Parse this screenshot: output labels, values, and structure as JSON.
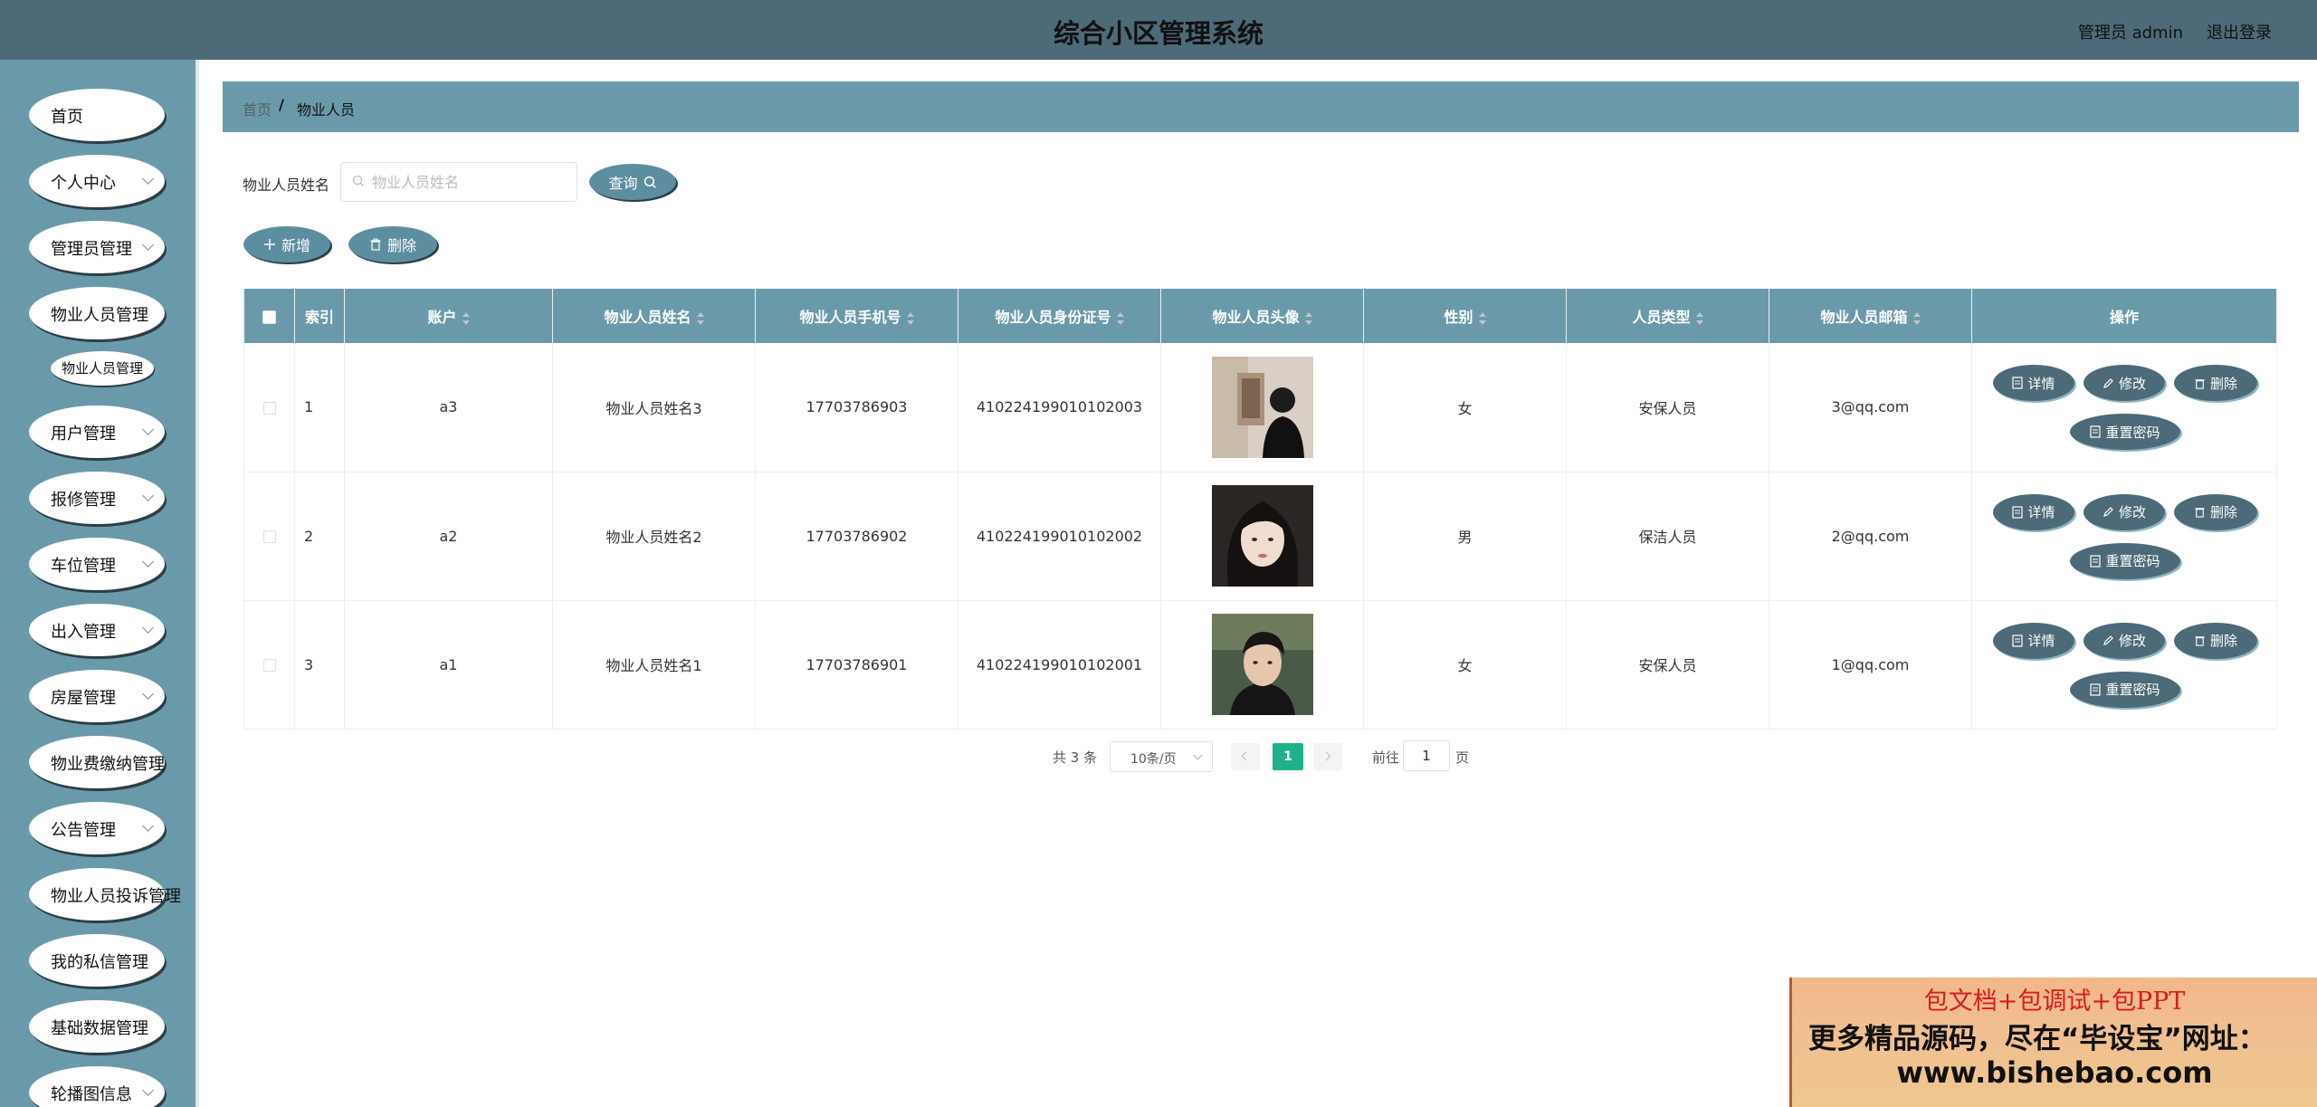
{
  "header": {
    "title": "综合小区管理系统",
    "user": "管理员 admin",
    "logout": "退出登录"
  },
  "sidebar": {
    "items": [
      {
        "label": "首页",
        "has_sub": false
      },
      {
        "label": "个人中心",
        "has_sub": true
      },
      {
        "label": "管理员管理",
        "has_sub": true
      },
      {
        "label": "物业人员管理",
        "has_sub": false
      },
      {
        "label": "用户管理",
        "has_sub": true
      },
      {
        "label": "报修管理",
        "has_sub": true
      },
      {
        "label": "车位管理",
        "has_sub": true
      },
      {
        "label": "出入管理",
        "has_sub": true
      },
      {
        "label": "房屋管理",
        "has_sub": true
      },
      {
        "label": "物业费缴纳管理",
        "has_sub": false
      },
      {
        "label": "公告管理",
        "has_sub": true
      },
      {
        "label": "物业人员投诉管理",
        "has_sub": false
      },
      {
        "label": "我的私信管理",
        "has_sub": false
      },
      {
        "label": "基础数据管理",
        "has_sub": false
      },
      {
        "label": "轮播图信息",
        "has_sub": true
      }
    ],
    "sub_item": "物业人员管理"
  },
  "breadcrumb": {
    "home": "首页",
    "separator": "/",
    "current": "物业人员"
  },
  "search": {
    "label": "物业人员姓名",
    "placeholder": "物业人员姓名",
    "value": "",
    "query_button": "查询"
  },
  "toolbar": {
    "add_button": "新增",
    "delete_button": "删除"
  },
  "table": {
    "columns": [
      "索引",
      "账户",
      "物业人员姓名",
      "物业人员手机号",
      "物业人员身份证号",
      "物业人员头像",
      "性别",
      "人员类型",
      "物业人员邮箱",
      "操作"
    ],
    "rows": [
      {
        "index": "1",
        "account": "a3",
        "name": "物业人员姓名3",
        "phone": "17703786903",
        "id_card": "410224199010102003",
        "avatar": "photo-back-view",
        "gender": "女",
        "type": "安保人员",
        "email": "3@qq.com"
      },
      {
        "index": "2",
        "account": "a2",
        "name": "物业人员姓名2",
        "phone": "17703786902",
        "id_card": "410224199010102002",
        "avatar": "photo-girl-portrait",
        "gender": "男",
        "type": "保洁人员",
        "email": "2@qq.com"
      },
      {
        "index": "3",
        "account": "a1",
        "name": "物业人员姓名1",
        "phone": "17703786901",
        "id_card": "410224199010102001",
        "avatar": "photo-boy-portrait",
        "gender": "女",
        "type": "安保人员",
        "email": "1@qq.com"
      }
    ],
    "actions": {
      "detail": "详情",
      "edit": "修改",
      "delete": "删除",
      "reset": "重置密码"
    }
  },
  "pagination": {
    "total": "共 3 条",
    "page_size": "10条/页",
    "current_page": "1",
    "goto_label": "前往",
    "goto_value": "1",
    "page_suffix": "页"
  },
  "banner": {
    "line1": "包文档+包调试+包PPT",
    "line2": "更多精品源码，尽在“毕设宝”网址：",
    "line3": "www.bishebao.com"
  },
  "colors": {
    "header_bg": "#4d6a78",
    "accent": "#6a9aaa",
    "button": "#5d8ea0",
    "pager_active": "#20b08a"
  }
}
